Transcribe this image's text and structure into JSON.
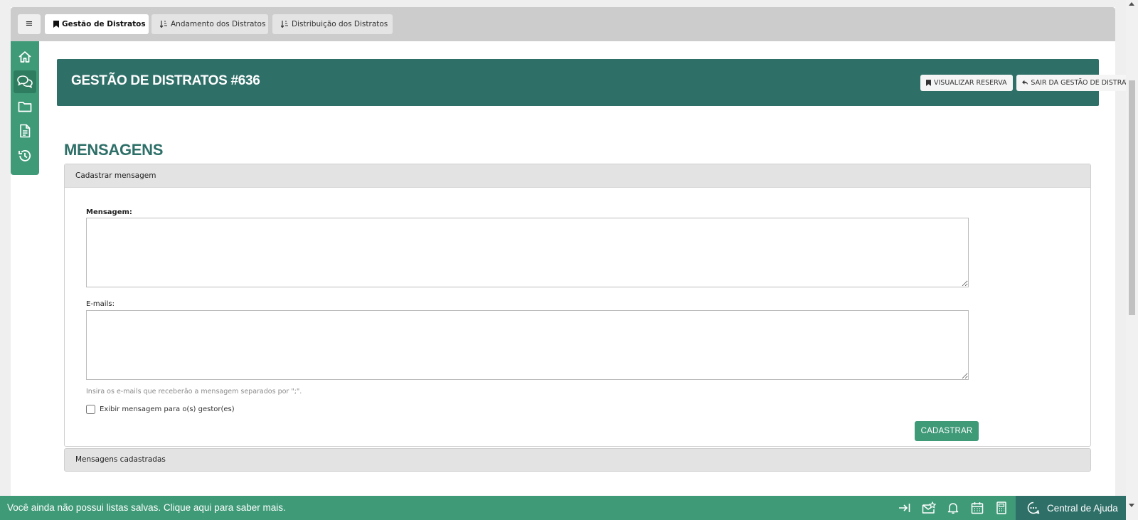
{
  "tabs": {
    "menu_glyph": "≡",
    "items": [
      {
        "label": "Gestão de Distratos",
        "icon": "bookmark-icon",
        "active": true
      },
      {
        "label": "Andamento dos Distratos",
        "icon": "sort-icon",
        "active": false
      },
      {
        "label": "Distribuição dos Distratos",
        "icon": "sort-icon",
        "active": false
      }
    ]
  },
  "sidebar": {
    "items": [
      {
        "icon": "home-icon",
        "active": false
      },
      {
        "icon": "chat-icon",
        "active": true
      },
      {
        "icon": "folder-icon",
        "active": false
      },
      {
        "icon": "document-icon",
        "active": false
      },
      {
        "icon": "history-icon",
        "active": false
      }
    ]
  },
  "header": {
    "title": "GESTÃO DE DISTRATOS #636",
    "buttons": {
      "view_reservation": "VISUALIZAR RESERVA",
      "exit": "SAIR DA GESTÃO DE DISTRATO"
    }
  },
  "section": {
    "title": "MENSAGENS"
  },
  "form": {
    "panel_title": "Cadastrar mensagem",
    "message_label": "Mensagem:",
    "message_value": "",
    "emails_label": "E-mails:",
    "emails_value": "",
    "emails_help": "Insira os e-mails que receberão a mensagem separados por \";\".",
    "checkbox_label": "Exibir mensagem para o(s) gestor(es)",
    "checkbox_checked": false,
    "submit_label": "CADASTRAR"
  },
  "registered": {
    "panel_title": "Mensagens cadastradas"
  },
  "footer": {
    "text": "Você ainda não possui listas salvas. Clique aqui para saber mais.",
    "icons": [
      "collapse-right-icon",
      "mail-star-icon",
      "bell-icon",
      "calendar-icon",
      "calculator-icon"
    ],
    "help_center_label": "Central de Ajuda"
  },
  "colors": {
    "primary": "#3f9a78",
    "header": "#2e6f68",
    "tabbar": "#cccccc"
  }
}
